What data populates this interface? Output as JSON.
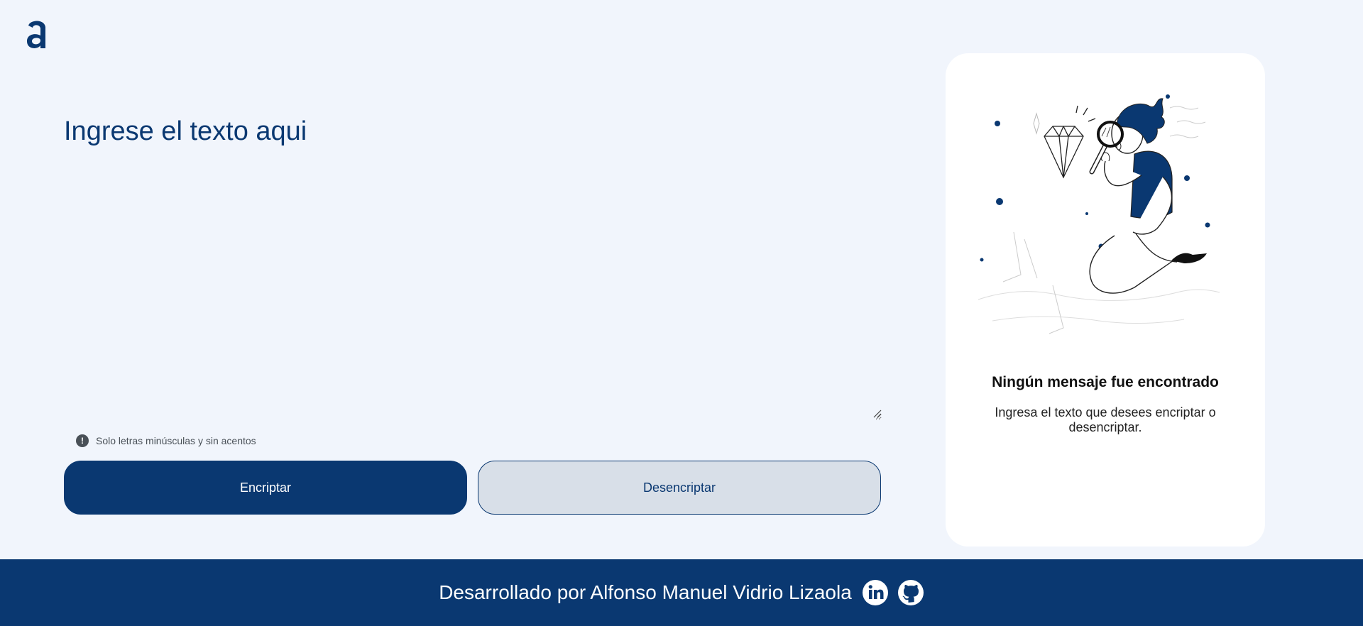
{
  "logo": {
    "icon": "alura-a-logo"
  },
  "input": {
    "placeholder": "Ingrese el texto aqui",
    "value": ""
  },
  "hint": {
    "icon": "exclamation-circle-icon",
    "text": "Solo letras minúsculas y sin acentos"
  },
  "buttons": {
    "encrypt_label": "Encriptar",
    "decrypt_label": "Desencriptar"
  },
  "panel": {
    "illustration": "person-with-magnifier-and-diamond",
    "title": "Ningún mensaje fue encontrado",
    "text": "Ingresa el texto que desees encriptar o desencriptar."
  },
  "footer": {
    "text": "Desarrollado por Alfonso Manuel Vidrio Lizaola",
    "links": [
      {
        "icon": "linkedin-icon"
      },
      {
        "icon": "github-icon"
      }
    ]
  },
  "colors": {
    "primary": "#0a3871",
    "background": "#f1f5fc",
    "secondary_button": "#d8dfe8",
    "panel": "#ffffff"
  }
}
